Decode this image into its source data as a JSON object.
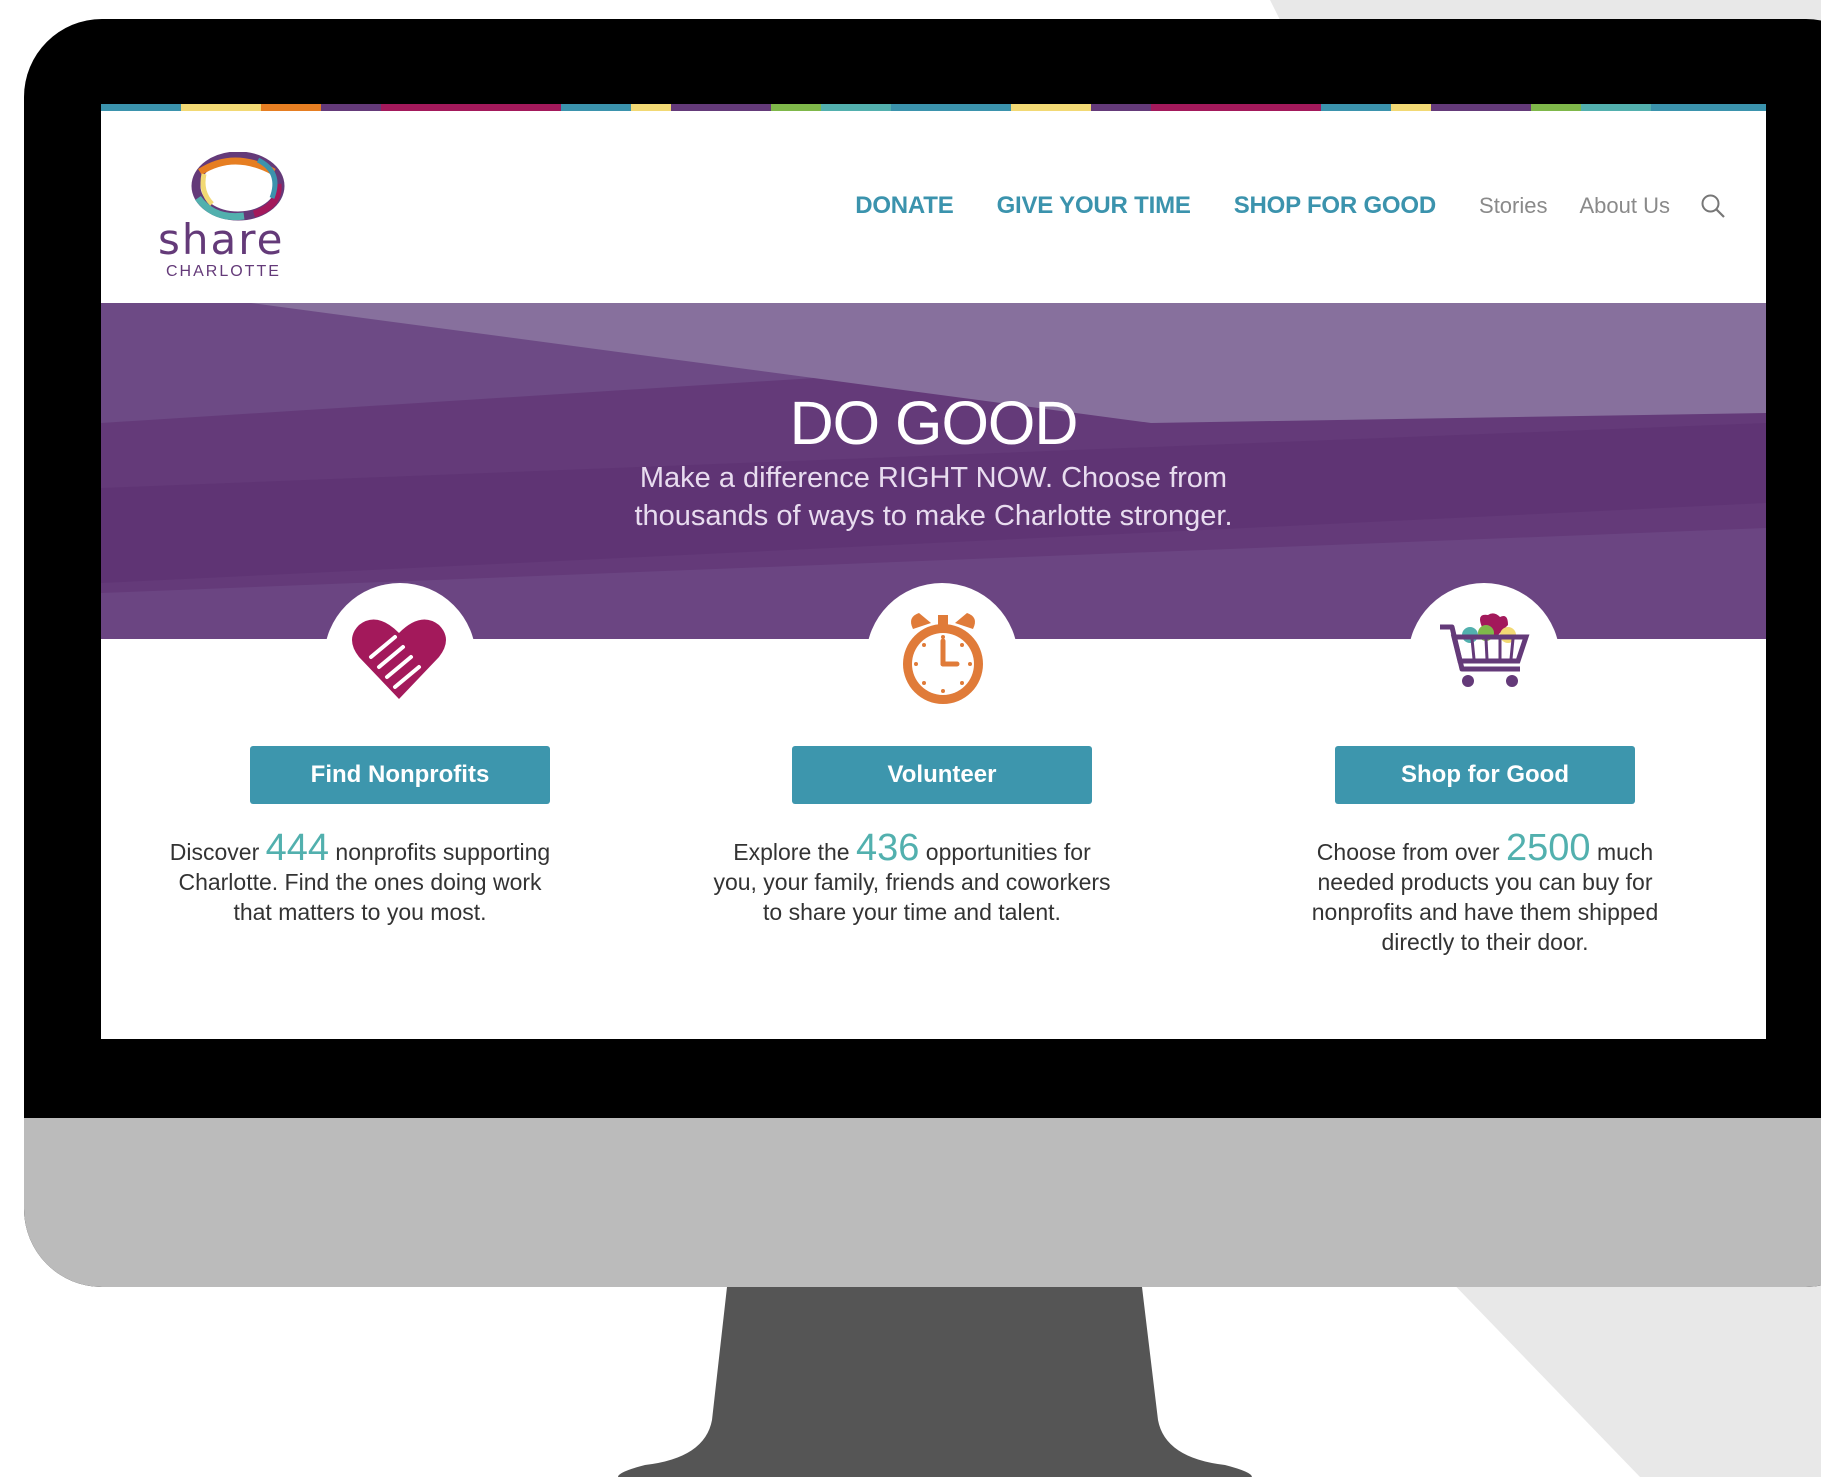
{
  "site": {
    "logo_word": "share",
    "logo_sub": "CHARLOTTE"
  },
  "nav": {
    "donate": "DONATE",
    "give_time": "GIVE YOUR TIME",
    "shop": "SHOP FOR GOOD",
    "stories": "Stories",
    "about": "About Us",
    "search_icon": "search-icon"
  },
  "hero": {
    "title": "DO GOOD",
    "subtitle_line1": "Make a difference RIGHT NOW. Choose from",
    "subtitle_line2": "thousands of ways to make Charlotte stronger."
  },
  "features": [
    {
      "icon": "heart-handshake-icon",
      "button": "Find Nonprofits",
      "pre": "Discover",
      "number": "444",
      "post": "nonprofits supporting",
      "line2": "Charlotte. Find the ones doing work",
      "line3": "that matters to you most.",
      "line4": ""
    },
    {
      "icon": "alarm-clock-icon",
      "button": "Volunteer",
      "pre": "Explore the",
      "number": "436",
      "post": "opportunities for",
      "line2": "you, your family, friends and coworkers",
      "line3": "to share your time and talent.",
      "line4": ""
    },
    {
      "icon": "shopping-cart-icon",
      "button": "Shop for Good",
      "pre": "Choose from over",
      "number": "2500",
      "post": "much",
      "line2": "needed products you can buy for",
      "line3": "nonprofits and have them shipped",
      "line4": "directly to their door."
    }
  ],
  "colors": {
    "brand_blue": "#3d96ad",
    "hero_purple": "#643a79",
    "accent_teal": "#52b0ae",
    "heart_magenta": "#a3195b",
    "clock_orange": "#e07b39"
  }
}
